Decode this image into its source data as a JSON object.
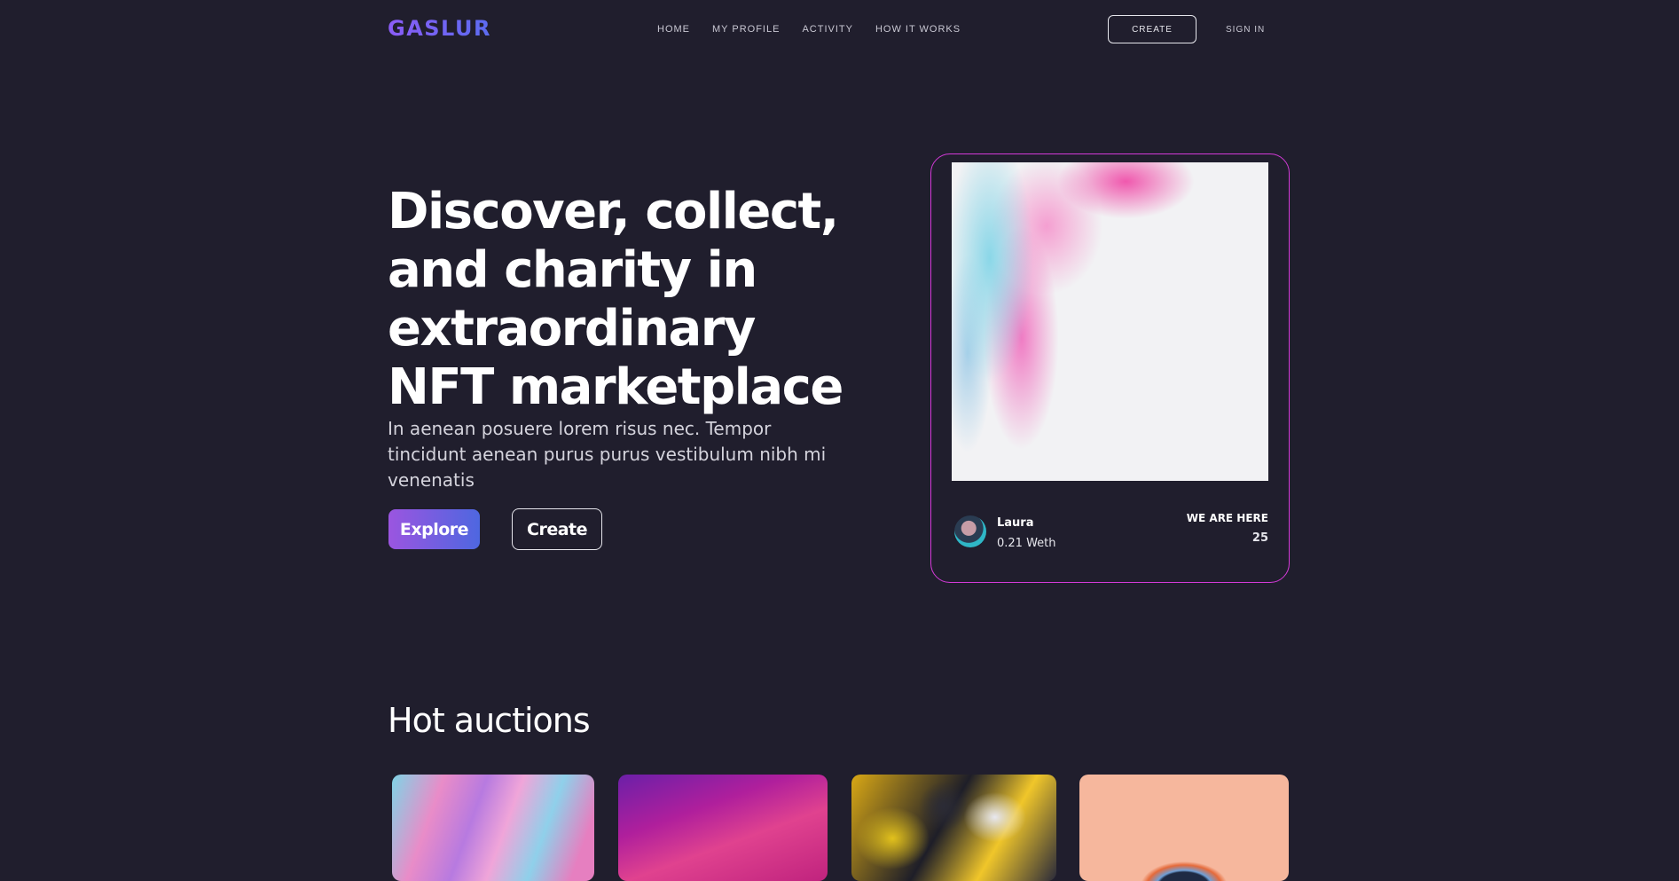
{
  "brand": {
    "logo": "GASLUR"
  },
  "nav": {
    "links": [
      "HOME",
      "MY PROFILE",
      "ACTIVITY",
      "HOW IT WORKS"
    ],
    "create_label": "CREATE",
    "signin_label": "SIGN IN"
  },
  "hero": {
    "title": "Discover, collect, and charity in extraordinary NFT marketplace",
    "subtitle": "In aenean posuere lorem risus nec. Tempor tincidunt aenean purus purus vestibulum nibh mi venenatis",
    "explore_label": "Explore",
    "create_label": "Create"
  },
  "featured": {
    "owner_name": "Laura",
    "price": "0.21 Weth",
    "label": "WE ARE HERE",
    "count": "25"
  },
  "auctions": {
    "title": "Hot auctions"
  },
  "colors": {
    "background": "#201e2d",
    "accent_gradient_start": "#9b55e0",
    "accent_gradient_end": "#4e67e0",
    "card_border": "#d43ad8"
  }
}
